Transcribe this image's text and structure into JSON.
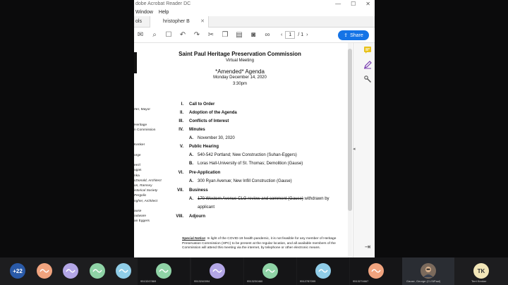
{
  "window": {
    "title": "dobe Acrobat Reader DC",
    "menu": [
      "Window",
      "Help"
    ],
    "tabs": {
      "tools": "ols",
      "doc": "hristopher B"
    },
    "page_current": "1",
    "page_total": "/ 1",
    "share_label": "Share"
  },
  "doc": {
    "org": "Saint Paul Heritage Preservation Commission",
    "subtitle": "Virtual Meeting",
    "agenda": "*Amended* Agenda",
    "date": "Monday December 14, 2020",
    "time": "3:30pm",
    "side_lines": [
      "rter, Mayor",
      "",
      "",
      "Heritage",
      "n Commission",
      "",
      "",
      "Kenker",
      "",
      "orge",
      "",
      "eezl",
      "ugas",
      "nka",
      "cDonald, Architect",
      "on, Ramsey",
      "istorical Society",
      "Pergolis",
      "ngher, Architect",
      "",
      "ause",
      "outware",
      "an Eggers"
    ],
    "items": [
      {
        "num": "I.",
        "text": "Call to Order",
        "bold": true
      },
      {
        "num": "II.",
        "text": "Adoption of the Agenda",
        "bold": true
      },
      {
        "num": "III.",
        "text": "Conflicts of Interest",
        "bold": true
      },
      {
        "num": "IV.",
        "text": "Minutes",
        "bold": true
      },
      {
        "sub": "A.",
        "text": "November 30, 2020"
      },
      {
        "num": "V.",
        "text": "Public Hearing",
        "bold": true
      },
      {
        "sub": "A.",
        "text": "540-542 Portland; New Construction (Suhan-Eggers)"
      },
      {
        "sub": "B.",
        "text": "Loras Hall-University of St. Thomas; Demolition (Gause)"
      },
      {
        "num": "VI.",
        "text": "Pre-Application",
        "bold": true
      },
      {
        "sub": "A.",
        "text": "300 Ryan Avenue; New Infill Construction (Gause)"
      },
      {
        "num": "VII.",
        "text": "Business",
        "bold": true
      },
      {
        "sub": "A.",
        "text_strike": "170 Western Avenue CLG review and comment (Gause)",
        "text_after": " withdrawn by",
        "text_cont": "applicant"
      },
      {
        "num": "VIII.",
        "text": "Adjourn",
        "bold": true
      }
    ],
    "notice_label": "Special Notice",
    "notice_text": ":  In light of the COVID-19 health pandemic, it is not feasible for any member of Heritage Preservation Commission (HPC) to be present at the regular location, and all available members of the Commission will attend this meeting via the internet, by telephone or other electronic means."
  },
  "dock": {
    "more": "+22",
    "tiles": [
      "9513247869",
      "9513240094",
      "9513230460",
      "9512787099",
      "9513274667"
    ],
    "cam_label": "Gause, George (CI-StPaul)",
    "tk_label": "Terri Kenker",
    "tk_initials": "TK"
  },
  "colors": {
    "share": "#1473e6",
    "sign_icon": "#e8c21b",
    "edit_icon": "#7a3fb0"
  }
}
